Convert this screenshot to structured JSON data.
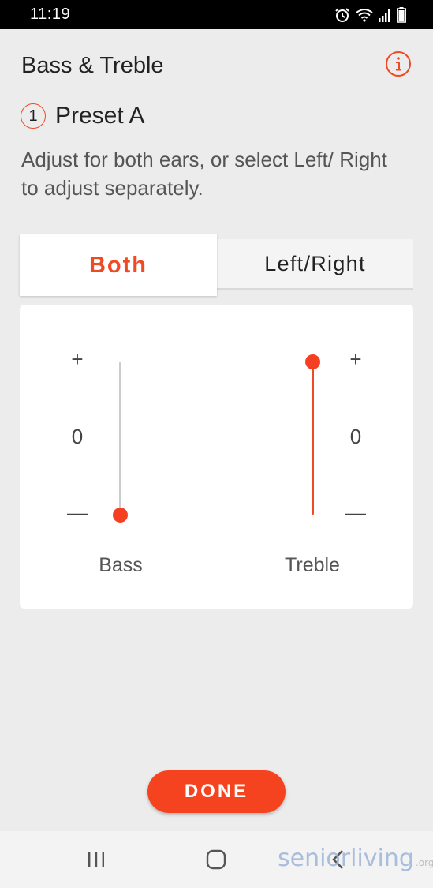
{
  "status_bar": {
    "time": "11:19",
    "icons": [
      "alarm-icon",
      "wifi-icon",
      "signal-icon",
      "battery-icon"
    ]
  },
  "header": {
    "title": "Bass & Treble",
    "info_icon": "info-icon"
  },
  "preset": {
    "number": "1",
    "label": "Preset A"
  },
  "instructions": "Adjust for both ears, or select Left/ Right to adjust separately.",
  "tabs": [
    {
      "label": "Both",
      "selected": true
    },
    {
      "label": "Left/Right",
      "selected": false
    }
  ],
  "sliders": {
    "bass": {
      "label": "Bass",
      "plus": "+",
      "zero": "0",
      "minus": "—",
      "level": 0.0
    },
    "treble": {
      "label": "Treble",
      "plus": "+",
      "zero": "0",
      "minus": "—",
      "level": 1.0
    }
  },
  "done_button": {
    "label": "DONE"
  },
  "nav_bar": {
    "items": [
      "recent-apps-icon",
      "home-icon",
      "back-icon"
    ]
  },
  "watermark": {
    "brand": "seniorliving",
    "suffix": ".org"
  },
  "colors": {
    "accent": "#f04a25",
    "background": "#ececec",
    "panel": "#ffffff",
    "track_inactive": "#cccccc"
  }
}
